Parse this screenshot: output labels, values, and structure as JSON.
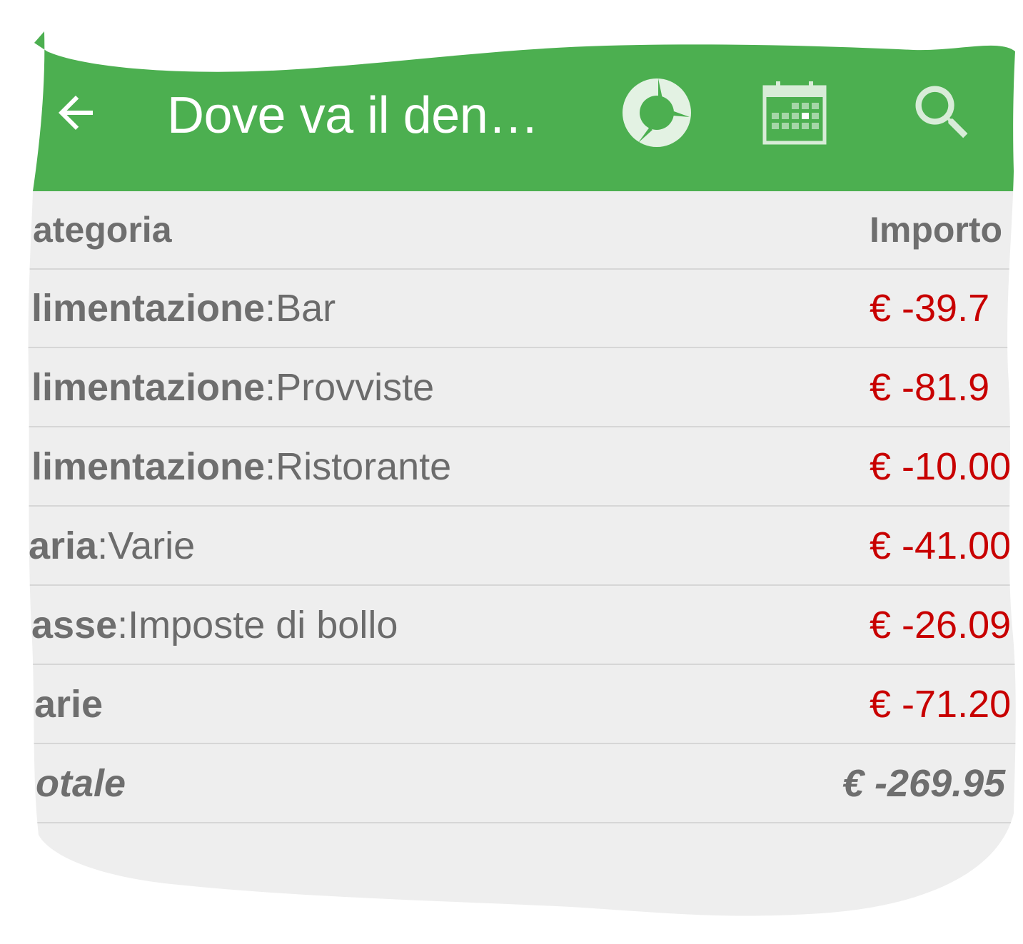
{
  "toolbar": {
    "title": "Dove va il den…",
    "actions": [
      {
        "icon": "pie-chart-icon"
      },
      {
        "icon": "calendar-icon"
      },
      {
        "icon": "search-icon"
      }
    ],
    "back_icon": "arrow-back-icon",
    "color": "#4caf50"
  },
  "table": {
    "headers": {
      "category": "ategoria",
      "amount": "Importo"
    },
    "rows": [
      {
        "category": "limentazione",
        "separator": " : ",
        "subcategory": "Bar",
        "amount": "€ -39.7"
      },
      {
        "category": "limentazione",
        "separator": " : ",
        "subcategory": "Provviste",
        "amount": "€ -81.9"
      },
      {
        "category": "limentazione",
        "separator": " : ",
        "subcategory": "Ristorante",
        "amount": "€ -10.00"
      },
      {
        "category": "aria",
        "separator": " : ",
        "subcategory": "Varie",
        "amount": "€ -41.00"
      },
      {
        "category": "asse",
        "separator": " : ",
        "subcategory": "Imposte di bollo",
        "amount": "€ -26.09"
      },
      {
        "category": "arie",
        "separator": "",
        "subcategory": "",
        "amount": "€ -71.20"
      }
    ],
    "total": {
      "label": "otale",
      "amount": "€ -269.95"
    },
    "amount_color": "#c80000"
  }
}
